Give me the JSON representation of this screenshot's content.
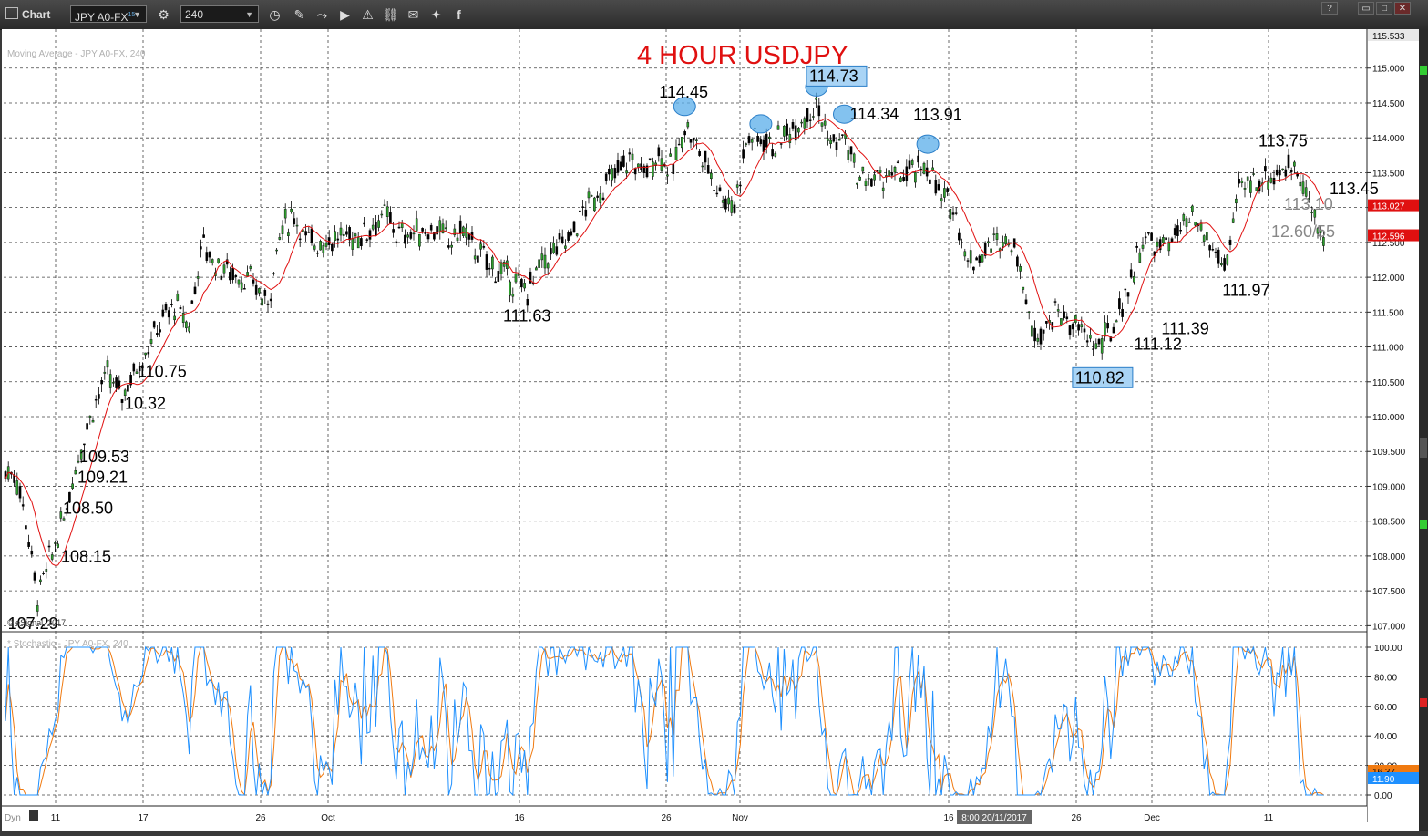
{
  "window": {
    "app_title": "Chart",
    "symbol": "JPY A0-FX",
    "symbol_superscript": "15",
    "interval": "240",
    "toolbar_icons": [
      "clock-icon",
      "pencil-icon",
      "line-chart-icon",
      "play-icon",
      "alert-icon",
      "link-icon",
      "comment-icon",
      "twitter-icon",
      "facebook-icon"
    ],
    "window_buttons": [
      "?",
      "▭",
      "□",
      "✕"
    ]
  },
  "price_pane": {
    "title": "4 HOUR USDJPY",
    "title_color": "#e01010",
    "study_label": "Moving Average - JPY A0-FX, 240",
    "copyright": "© eSignal, 2017",
    "y_ticks": [
      "107.000",
      "107.500",
      "108.000",
      "108.500",
      "109.000",
      "109.500",
      "110.000",
      "110.500",
      "111.000",
      "111.500",
      "112.000",
      "112.500",
      "113.000",
      "113.500",
      "114.000",
      "114.500",
      "115.000"
    ],
    "top_tag": "115.533",
    "ma_tag": "113.027",
    "price_tag": "112.596",
    "ma_color": "#e01010",
    "highlight_color": "#5aaeea"
  },
  "stoch_pane": {
    "study_label": "* Stochastic - JPY A0-FX, 240",
    "y_ticks": [
      "0.00",
      "20.00",
      "40.00",
      "60.00",
      "80.00",
      "100.00"
    ],
    "k_tag": "16.37",
    "d_tag": "11.90",
    "k_color": "#f07a10",
    "d_color": "#1e90ff"
  },
  "x_axis": {
    "labels": [
      "11",
      "17",
      "26",
      "Oct",
      "16",
      "26",
      "Nov",
      "16",
      "26",
      "Dec",
      "11"
    ],
    "cursor_label": "8:00 20/11/2017",
    "corner_label": "Dyn"
  },
  "chart_data": {
    "type": "candlestick",
    "title": "4 HOUR USDJPY",
    "ylim": [
      106.9,
      115.533
    ],
    "key_levels": [
      {
        "x": "Sep 08",
        "y": 107.29
      },
      {
        "x": "Sep 11",
        "y": 108.15
      },
      {
        "x": "Sep 11",
        "y": 108.5
      },
      {
        "x": "Sep 12",
        "y": 109.21
      },
      {
        "x": "Sep 14",
        "y": 109.53
      },
      {
        "x": "Sep 15",
        "y": 110.32
      },
      {
        "x": "Sep 16",
        "y": 110.75
      },
      {
        "x": "Oct 16",
        "y": 111.63
      },
      {
        "x": "Oct 27",
        "y": 114.45
      },
      {
        "x": "Nov 06",
        "y": 114.73
      },
      {
        "x": "Nov 08",
        "y": 114.34
      },
      {
        "x": "Nov 14",
        "y": 113.91
      },
      {
        "x": "Nov 27",
        "y": 110.82
      },
      {
        "x": "Nov 28",
        "y": 111.12
      },
      {
        "x": "Dec 01",
        "y": 111.39
      },
      {
        "x": "Dec 07",
        "y": 111.97
      },
      {
        "x": "Dec 11",
        "y": 113.1
      },
      {
        "x": "Dec 12",
        "y": 113.75
      },
      {
        "x": "Dec 13",
        "y": 113.45
      },
      {
        "x": "Dec 13",
        "y": 112.6
      },
      {
        "x": "Dec 13",
        "y": 112.55
      }
    ],
    "annotations": [
      {
        "text": "107.29",
        "x": "Sep 08",
        "y": 107.29,
        "boxed": false
      },
      {
        "text": "108.15",
        "x": "Sep 11",
        "y": 108.15,
        "boxed": false
      },
      {
        "text": "108.50",
        "x": "Sep 11",
        "y": 108.5,
        "boxed": false
      },
      {
        "text": "109.21",
        "x": "Sep 12",
        "y": 109.21,
        "boxed": false
      },
      {
        "text": "109.53",
        "x": "Sep 14",
        "y": 109.53,
        "boxed": false
      },
      {
        "text": "10.32",
        "x": "Sep 15",
        "y": 110.32,
        "boxed": false
      },
      {
        "text": "110.75",
        "x": "Sep 16",
        "y": 110.75,
        "boxed": false
      },
      {
        "text": "111.63",
        "x": "Oct 16",
        "y": 111.63,
        "boxed": false
      },
      {
        "text": "114.45",
        "x": "Oct 27",
        "y": 114.45,
        "boxed": false
      },
      {
        "text": "114.73",
        "x": "Nov 06",
        "y": 114.73,
        "boxed": true
      },
      {
        "text": "114.34",
        "x": "Nov 08",
        "y": 114.34,
        "boxed": false
      },
      {
        "text": "113.91",
        "x": "Nov 14",
        "y": 113.91,
        "boxed": false
      },
      {
        "text": "110.82",
        "x": "Nov 27",
        "y": 110.82,
        "boxed": true
      },
      {
        "text": "111.12",
        "x": "Nov 28",
        "y": 111.12,
        "boxed": false
      },
      {
        "text": "111.39",
        "x": "Dec 01",
        "y": 111.39,
        "boxed": false
      },
      {
        "text": "111.97",
        "x": "Dec 07",
        "y": 111.97,
        "boxed": false
      },
      {
        "text": "113.10",
        "x": "Dec 11",
        "y": 113.1,
        "boxed": false
      },
      {
        "text": "113.75",
        "x": "Dec 12",
        "y": 113.75,
        "boxed": false
      },
      {
        "text": "113.45",
        "x": "Dec 13",
        "y": 113.45,
        "boxed": false
      },
      {
        "text": "12.60/55",
        "x": "Dec 13",
        "y": 112.6,
        "boxed": false
      }
    ],
    "highlighted_peaks": [
      {
        "x": "Oct 27",
        "y": 114.45
      },
      {
        "x": "Nov 02",
        "y": 114.2
      },
      {
        "x": "Nov 06",
        "y": 114.73
      },
      {
        "x": "Nov 08",
        "y": 114.34
      },
      {
        "x": "Nov 14",
        "y": 113.91
      }
    ],
    "path_points": [
      {
        "x": "Sep 05",
        "y": 109.2
      },
      {
        "x": "Sep 06",
        "y": 108.8
      },
      {
        "x": "Sep 07",
        "y": 108.2
      },
      {
        "x": "Sep 08",
        "y": 107.4
      },
      {
        "x": "Sep 11",
        "y": 108.5
      },
      {
        "x": "Sep 12",
        "y": 109.4
      },
      {
        "x": "Sep 13",
        "y": 110.1
      },
      {
        "x": "Sep 14",
        "y": 110.6
      },
      {
        "x": "Sep 15",
        "y": 110.3
      },
      {
        "x": "Sep 18",
        "y": 111.4
      },
      {
        "x": "Sep 19",
        "y": 111.6
      },
      {
        "x": "Sep 20",
        "y": 111.3
      },
      {
        "x": "Sep 21",
        "y": 112.5
      },
      {
        "x": "Sep 22",
        "y": 112.2
      },
      {
        "x": "Sep 25",
        "y": 111.9
      },
      {
        "x": "Sep 26",
        "y": 111.6
      },
      {
        "x": "Sep 27",
        "y": 112.7
      },
      {
        "x": "Sep 28",
        "y": 112.9
      },
      {
        "x": "Sep 29",
        "y": 112.5
      },
      {
        "x": "Oct 03",
        "y": 112.6
      },
      {
        "x": "Oct 05",
        "y": 112.9
      },
      {
        "x": "Oct 06",
        "y": 112.6
      },
      {
        "x": "Oct 09",
        "y": 112.7
      },
      {
        "x": "Oct 10",
        "y": 112.5
      },
      {
        "x": "Oct 11",
        "y": 112.7
      },
      {
        "x": "Oct 12",
        "y": 112.4
      },
      {
        "x": "Oct 13",
        "y": 112.2
      },
      {
        "x": "Oct 16",
        "y": 111.8
      },
      {
        "x": "Oct 17",
        "y": 112.2
      },
      {
        "x": "Oct 19",
        "y": 112.6
      },
      {
        "x": "Oct 20",
        "y": 113.0
      },
      {
        "x": "Oct 23",
        "y": 113.7
      },
      {
        "x": "Oct 24",
        "y": 113.5
      },
      {
        "x": "Oct 25",
        "y": 113.8
      },
      {
        "x": "Oct 26",
        "y": 113.5
      },
      {
        "x": "Oct 27",
        "y": 114.2
      },
      {
        "x": "Oct 30",
        "y": 113.2
      },
      {
        "x": "Oct 31",
        "y": 113.0
      },
      {
        "x": "Nov 01",
        "y": 114.0
      },
      {
        "x": "Nov 02",
        "y": 114.0
      },
      {
        "x": "Nov 03",
        "y": 113.9
      },
      {
        "x": "Nov 06",
        "y": 114.5
      },
      {
        "x": "Nov 07",
        "y": 113.9
      },
      {
        "x": "Nov 08",
        "y": 114.0
      },
      {
        "x": "Nov 09",
        "y": 113.4
      },
      {
        "x": "Nov 10",
        "y": 113.4
      },
      {
        "x": "Nov 13",
        "y": 113.5
      },
      {
        "x": "Nov 14",
        "y": 113.6
      },
      {
        "x": "Nov 15",
        "y": 113.1
      },
      {
        "x": "Nov 16",
        "y": 113.0
      },
      {
        "x": "Nov 17",
        "y": 112.2
      },
      {
        "x": "Nov 20",
        "y": 112.6
      },
      {
        "x": "Nov 21",
        "y": 112.3
      },
      {
        "x": "Nov 22",
        "y": 111.2
      },
      {
        "x": "Nov 23",
        "y": 111.3
      },
      {
        "x": "Nov 24",
        "y": 111.5
      },
      {
        "x": "Nov 27",
        "y": 111.0
      },
      {
        "x": "Nov 28",
        "y": 111.3
      },
      {
        "x": "Nov 29",
        "y": 111.9
      },
      {
        "x": "Nov 30",
        "y": 112.6
      },
      {
        "x": "Dec 01",
        "y": 112.4
      },
      {
        "x": "Dec 04",
        "y": 112.8
      },
      {
        "x": "Dec 05",
        "y": 112.6
      },
      {
        "x": "Dec 06",
        "y": 112.3
      },
      {
        "x": "Dec 07",
        "y": 112.2
      },
      {
        "x": "Dec 08",
        "y": 113.3
      },
      {
        "x": "Dec 11",
        "y": 113.5
      },
      {
        "x": "Dec 12",
        "y": 113.6
      },
      {
        "x": "Dec 13",
        "y": 112.6
      }
    ]
  }
}
